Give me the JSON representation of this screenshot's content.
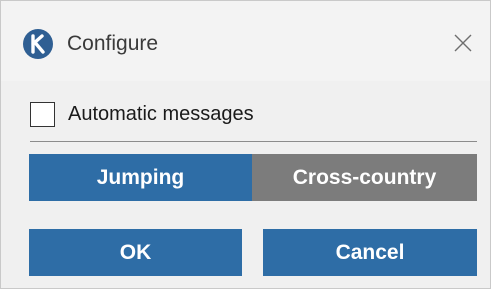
{
  "window": {
    "title": "Configure",
    "logo_icon": "k-logo-icon",
    "close_icon": "close-icon",
    "close_glyph": "✕"
  },
  "options": {
    "automatic_messages": {
      "label": "Automatic messages",
      "checked": false
    }
  },
  "mode_toggle": {
    "options": [
      "Jumping",
      "Cross-country"
    ],
    "selected": "Jumping"
  },
  "buttons": {
    "ok_label": "OK",
    "cancel_label": "Cancel"
  },
  "colors": {
    "accent": "#2e6da6",
    "inactive": "#7c7c7c",
    "background": "#f0f0f0"
  }
}
